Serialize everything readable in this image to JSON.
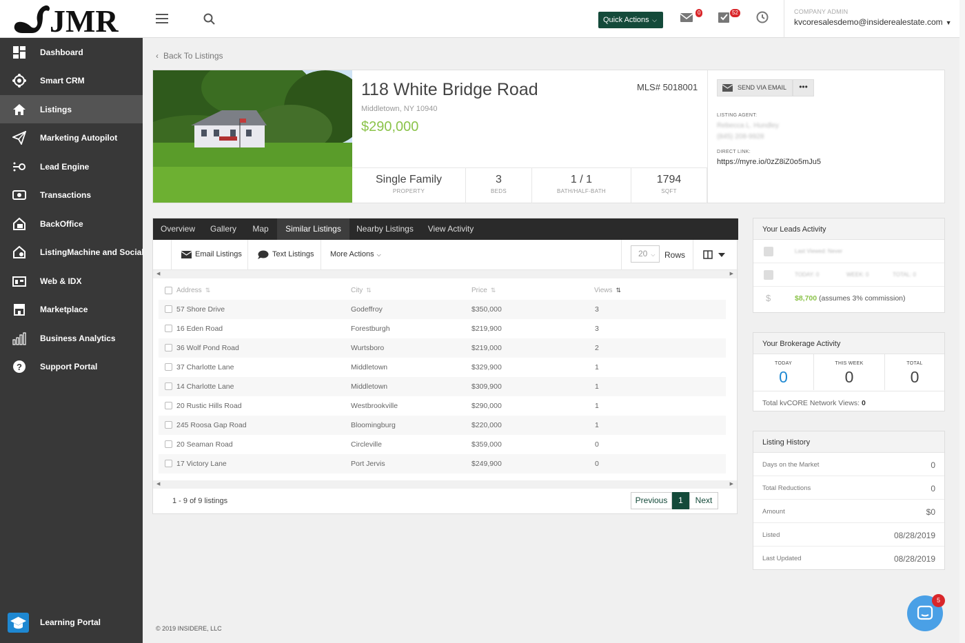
{
  "header": {
    "logo_text": "JMR",
    "quick_actions_label": "Quick Actions",
    "mail_badge": "0",
    "tasks_badge": "52",
    "account_role": "COMPANY ADMIN",
    "account_email": "kvcoresalesdemo@insiderealestate.com"
  },
  "sidebar": {
    "items": [
      {
        "label": "Dashboard",
        "icon": "dashboard-icon"
      },
      {
        "label": "Smart CRM",
        "icon": "crm-icon"
      },
      {
        "label": "Listings",
        "icon": "home-icon",
        "active": true
      },
      {
        "label": "Marketing Autopilot",
        "icon": "paper-plane-icon"
      },
      {
        "label": "Lead Engine",
        "icon": "lead-engine-icon"
      },
      {
        "label": "Transactions",
        "icon": "transactions-icon"
      },
      {
        "label": "BackOffice",
        "icon": "backoffice-icon"
      },
      {
        "label": "ListingMachine and Social",
        "icon": "listingmachine-icon"
      },
      {
        "label": "Web & IDX",
        "icon": "web-idx-icon"
      },
      {
        "label": "Marketplace",
        "icon": "marketplace-icon"
      },
      {
        "label": "Business Analytics",
        "icon": "analytics-icon"
      },
      {
        "label": "Support Portal",
        "icon": "question-icon"
      }
    ],
    "learning_portal": "Learning Portal"
  },
  "back_link": "Back To Listings",
  "property": {
    "address": "118 White Bridge Road",
    "mls": "MLS# 5018001",
    "city": "Middletown, NY 10940",
    "price": "$290,000",
    "stats": [
      {
        "value": "Single Family",
        "label": "PROPERTY"
      },
      {
        "value": "3",
        "label": "BEDS"
      },
      {
        "value": "1 / 1",
        "label": "BATH/HALF-BATH"
      },
      {
        "value": "1794",
        "label": "SQFT"
      }
    ],
    "send_email_label": "SEND VIA EMAIL",
    "more_label": "•••",
    "listing_agent_label": "LISTING AGENT:",
    "agent_name": "Rebecca L. Hundley",
    "agent_phone": "(845) 208-9928",
    "direct_link_label": "DIRECT LINK:",
    "direct_link": "https://myre.io/0zZ8iZ0o5mJu5"
  },
  "tabs": [
    "Overview",
    "Gallery",
    "Map",
    "Similar Listings",
    "Nearby Listings",
    "View Activity"
  ],
  "active_tab": "Similar Listings",
  "toolbar": {
    "email_listings": "Email Listings",
    "text_listings": "Text Listings",
    "more_actions": "More Actions",
    "rows_value": "20",
    "rows_label": "Rows"
  },
  "table": {
    "columns": [
      "Address",
      "City",
      "Price",
      "Views"
    ],
    "rows": [
      [
        "57 Shore Drive",
        "Godeffroy",
        "$350,000",
        "3"
      ],
      [
        "16 Eden Road",
        "Forestburgh",
        "$219,900",
        "3"
      ],
      [
        "36 Wolf Pond Road",
        "Wurtsboro",
        "$219,000",
        "2"
      ],
      [
        "37 Charlotte Lane",
        "Middletown",
        "$329,900",
        "1"
      ],
      [
        "14 Charlotte Lane",
        "Middletown",
        "$309,900",
        "1"
      ],
      [
        "20 Rustic Hills Road",
        "Westbrookville",
        "$290,000",
        "1"
      ],
      [
        "245 Roosa Gap Road",
        "Bloomingburg",
        "$220,000",
        "1"
      ],
      [
        "20 Seaman Road",
        "Circleville",
        "$359,000",
        "0"
      ],
      [
        "17 Victory Lane",
        "Port Jervis",
        "$249,900",
        "0"
      ]
    ],
    "summary": "1 - 9 of 9 listings",
    "prev": "Previous",
    "page": "1",
    "next": "Next"
  },
  "leads_activity": {
    "title": "Your Leads Activity",
    "last_viewed": "Last Viewed: Never",
    "today": "TODAY: 0",
    "week": "WEEK: 0",
    "total": "TOTAL: 0",
    "commission_value": "$8,700",
    "commission_note": "(assumes 3% commission)"
  },
  "brokerage_activity": {
    "title": "Your Brokerage Activity",
    "cols": [
      {
        "label": "TODAY",
        "value": "0"
      },
      {
        "label": "THIS WEEK",
        "value": "0"
      },
      {
        "label": "TOTAL",
        "value": "0"
      }
    ],
    "network_label": "Total kvCORE Network Views:",
    "network_value": "0"
  },
  "listing_history": {
    "title": "Listing History",
    "rows": [
      {
        "label": "Days on the Market",
        "value": "0"
      },
      {
        "label": "Total Reductions",
        "value": "0"
      },
      {
        "label": "Amount",
        "value": "$0"
      },
      {
        "label": "Listed",
        "value": "08/28/2019"
      },
      {
        "label": "Last Updated",
        "value": "08/28/2019"
      }
    ]
  },
  "footer": {
    "copyright": "© 2019 INSIDERE, LLC"
  },
  "chat_badge": "5",
  "colors": {
    "accent": "#144a3a",
    "price_green": "#8bc34a",
    "sidebar": "#383838",
    "badge_red": "#d9262a",
    "link_blue": "#1e88d2"
  }
}
